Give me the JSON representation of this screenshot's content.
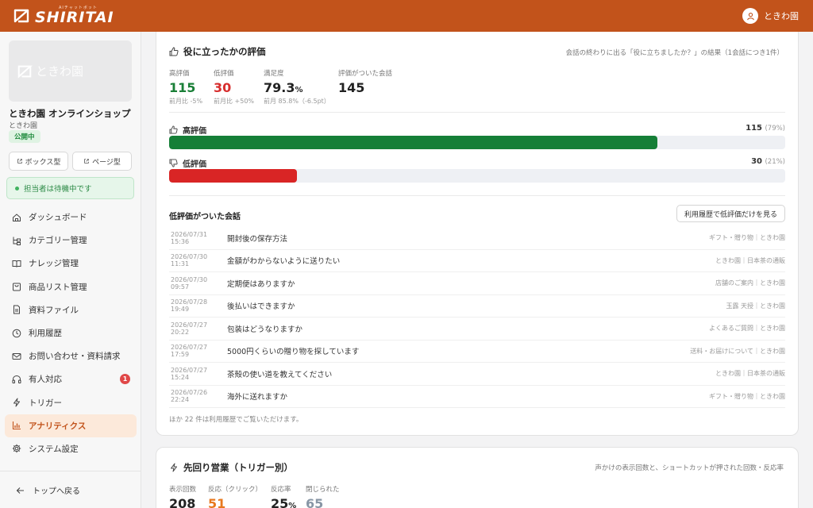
{
  "header": {
    "brand_sub": "AIチャットボット",
    "brand_name": "SHIRITAI",
    "user_name": "ときわ園"
  },
  "sidebar": {
    "thumb_text": "ときわ園",
    "shop_name": "ときわ園 オンラインショップ",
    "shop_owner": "ときわ園",
    "status_badge": "公開中",
    "box_btn": "ボックス型",
    "page_btn": "ページ型",
    "staff_status": "担当者は待機中です",
    "items": [
      {
        "label": "ダッシュボード",
        "icon": "home-icon"
      },
      {
        "label": "カテゴリー管理",
        "icon": "tree-icon"
      },
      {
        "label": "ナレッジ管理",
        "icon": "book-icon"
      },
      {
        "label": "商品リスト管理",
        "icon": "bag-icon"
      },
      {
        "label": "資料ファイル",
        "icon": "file-icon"
      },
      {
        "label": "利用履歴",
        "icon": "clock-icon"
      },
      {
        "label": "お問い合わせ・資料請求",
        "icon": "mail-icon"
      },
      {
        "label": "有人対応",
        "icon": "headset-icon",
        "badge": "1"
      },
      {
        "label": "トリガー",
        "icon": "bolt-icon"
      },
      {
        "label": "アナリティクス",
        "icon": "chart-icon",
        "active": true
      },
      {
        "label": "システム設定",
        "icon": "gear-icon"
      }
    ],
    "back_label": "トップへ戻る"
  },
  "rating_card": {
    "title": "役に立ったかの評価",
    "note": "会話の終わりに出る「役に立ちましたか？」の結果（1会話につき1件）",
    "metrics": [
      {
        "label": "高評価",
        "value": "115",
        "sub": "前月比 -5%"
      },
      {
        "label": "低評価",
        "value": "30",
        "sub": "前月比 +50%"
      },
      {
        "label": "満足度",
        "value": "79.3",
        "unit": "%",
        "sub": "前月 85.8%（-6.5pt）"
      },
      {
        "label": "評価がついた会話",
        "value": "145",
        "sub": ""
      }
    ],
    "bars": [
      {
        "label": "高評価",
        "count": "115",
        "pct_text": "(79%)",
        "fraction": 0.793,
        "color": "#157f37"
      },
      {
        "label": "低評価",
        "count": "30",
        "pct_text": "(21%)",
        "fraction": 0.207,
        "color": "#d92525"
      }
    ],
    "low_title": "低評価がついた会話",
    "low_button": "利用履歴で低評価だけを見る",
    "conversations": [
      {
        "date": "2026/07/31 15:36",
        "question": "開封後の保存方法",
        "category": "ギフト・贈り物｜ときわ園"
      },
      {
        "date": "2026/07/30 11:31",
        "question": "金額がわからないように送りたい",
        "category": "ときわ園｜日本茶の通販"
      },
      {
        "date": "2026/07/30 09:57",
        "question": "定期便はありますか",
        "category": "店舗のご案内｜ときわ園"
      },
      {
        "date": "2026/07/28 19:49",
        "question": "後払いはできますか",
        "category": "玉露 天授｜ときわ園"
      },
      {
        "date": "2026/07/27 20:22",
        "question": "包装はどうなりますか",
        "category": "よくあるご質問｜ときわ園"
      },
      {
        "date": "2026/07/27 17:59",
        "question": "5000円くらいの贈り物を探しています",
        "category": "送料・お届けについて｜ときわ園"
      },
      {
        "date": "2026/07/27 15:24",
        "question": "茶殻の使い道を教えてください",
        "category": "ときわ園｜日本茶の通販"
      },
      {
        "date": "2026/07/26 22:24",
        "question": "海外に送れますか",
        "category": "ギフト・贈り物｜ときわ園"
      }
    ],
    "more_note": "ほか 22 件は利用履歴でご覧いただけます。"
  },
  "trigger_card": {
    "title": "先回り営業（トリガー別）",
    "note": "声かけの表示回数と、ショートカットが押された回数・反応率",
    "metrics": [
      {
        "label": "表示回数",
        "value": "208"
      },
      {
        "label": "反応（クリック）",
        "value": "51"
      },
      {
        "label": "反応率",
        "value": "25",
        "unit": "%"
      },
      {
        "label": "閉じられた",
        "value": "65"
      }
    ]
  }
}
